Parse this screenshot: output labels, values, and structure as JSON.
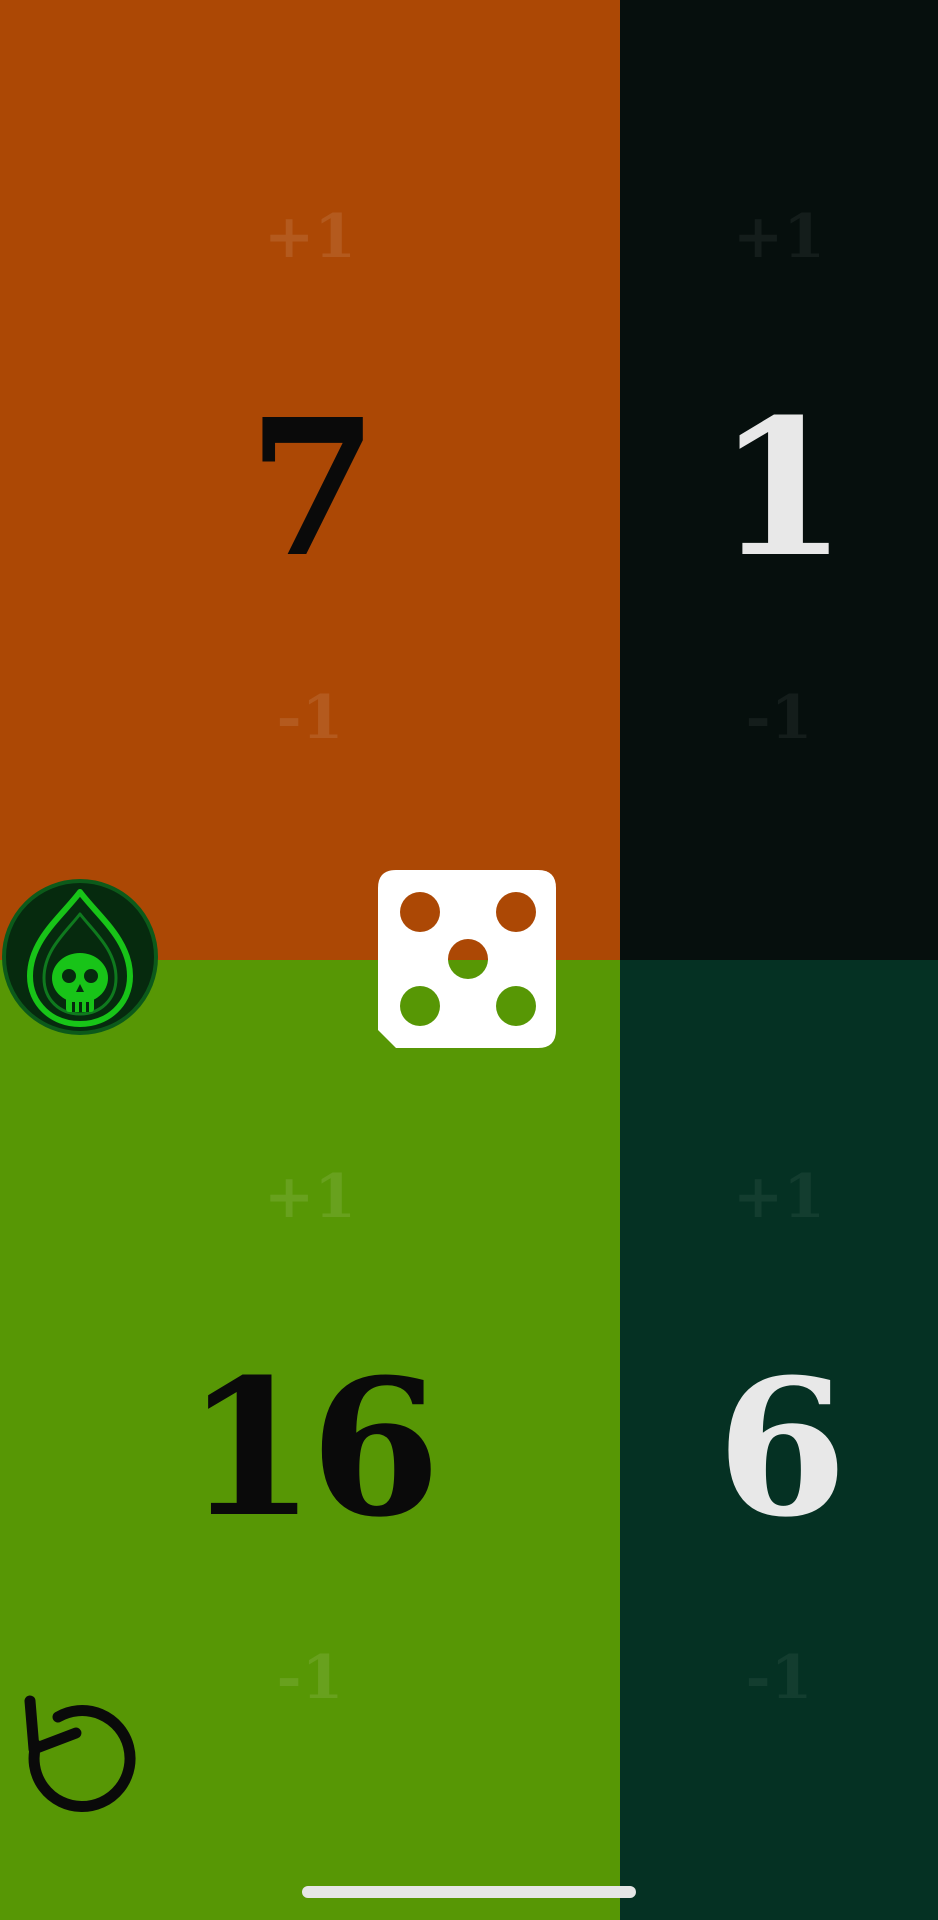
{
  "players": [
    {
      "id": "top-left",
      "life": "7",
      "increment_label": "+1",
      "decrement_label": "-1",
      "background": "#ac4805"
    },
    {
      "id": "top-right",
      "life": "1",
      "increment_label": "+1",
      "decrement_label": "-1",
      "background": "#060f0d"
    },
    {
      "id": "bottom-left",
      "life": "16",
      "increment_label": "+1",
      "decrement_label": "-1",
      "background": "#579705"
    },
    {
      "id": "bottom-right",
      "life": "6",
      "increment_label": "+1",
      "decrement_label": "-1",
      "background": "#053123"
    }
  ],
  "controls": {
    "poison_icon": "skull-poison-drop-icon",
    "dice_icon": "dice-five-icon",
    "dice_value": 5,
    "reset_icon": "reset-arrow-icon"
  },
  "colors": {
    "poison_green": "#18c418",
    "dice_face": "#ffffff",
    "home_indicator": "#e6e6e6"
  }
}
